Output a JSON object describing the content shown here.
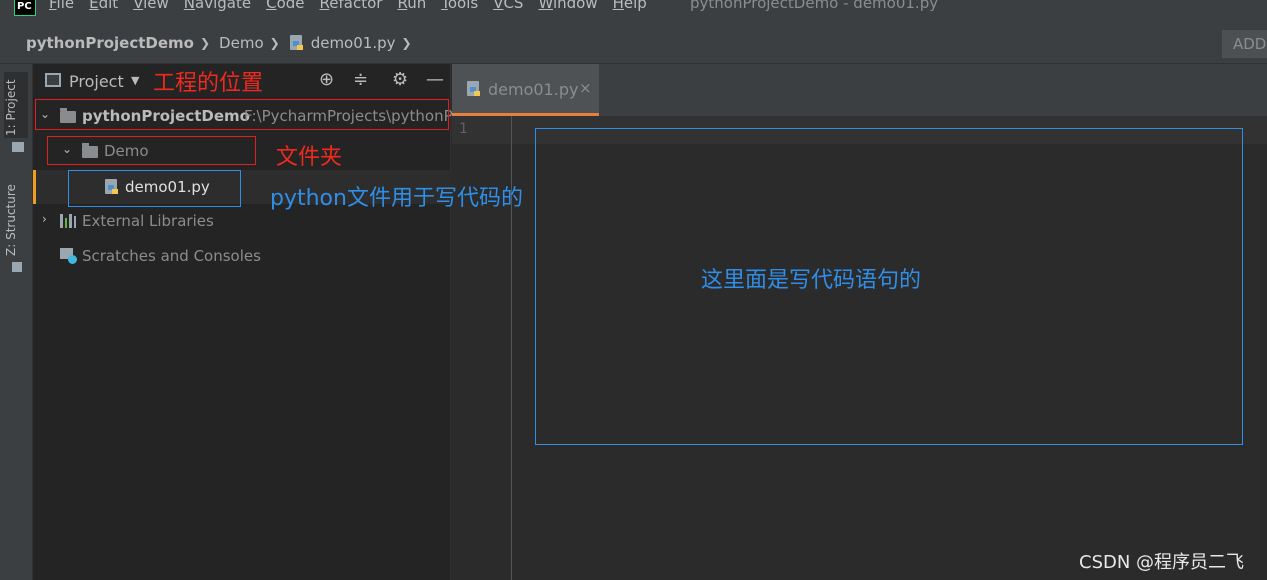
{
  "menubar": {
    "logo_text": "PC",
    "items": [
      {
        "mnemonic": "F",
        "rest": "ile"
      },
      {
        "mnemonic": "E",
        "rest": "dit"
      },
      {
        "mnemonic": "V",
        "rest": "iew"
      },
      {
        "mnemonic": "N",
        "rest": "avigate"
      },
      {
        "mnemonic": "C",
        "rest": "ode"
      },
      {
        "mnemonic": "R",
        "rest": "efactor"
      },
      {
        "mnemonic": "R",
        "rest": "un"
      },
      {
        "mnemonic": "T",
        "rest": "ools"
      },
      {
        "mnemonic": "V",
        "rest": "CS"
      },
      {
        "mnemonic": "W",
        "rest": "indow"
      },
      {
        "mnemonic": "H",
        "rest": "elp"
      }
    ],
    "window_title": "pythonProjectDemo - demo01.py"
  },
  "breadcrumb": {
    "project": "pythonProjectDemo",
    "folder": "Demo",
    "file": "demo01.py",
    "separator": "❯"
  },
  "add_button": "ADD",
  "left_strip": {
    "project_tab": "1: Project",
    "structure_tab": "Z: Structure"
  },
  "project_panel": {
    "title": "Project",
    "tree": {
      "root_name": "pythonProjectDemo",
      "root_path": "F:\\PycharmProjects\\pythonP",
      "folder_name": "Demo",
      "file_name": "demo01.py",
      "external_libraries": "External Libraries",
      "scratches": "Scratches and Consoles"
    }
  },
  "annotations": {
    "project_location": "工程的位置",
    "folder": "文件夹",
    "python_file": "python文件用于写代码的",
    "editor_area": "这里面是写代码语句的"
  },
  "editor": {
    "tab_label": "demo01.py",
    "close_glyph": "×",
    "line_number": "1"
  },
  "watermark": "CSDN @程序员二飞",
  "colors": {
    "annotation_red": "#f02a1f",
    "annotation_blue": "#2f8ee8",
    "selected_accent": "#f29d22",
    "tab_accent": "#e8803b"
  }
}
